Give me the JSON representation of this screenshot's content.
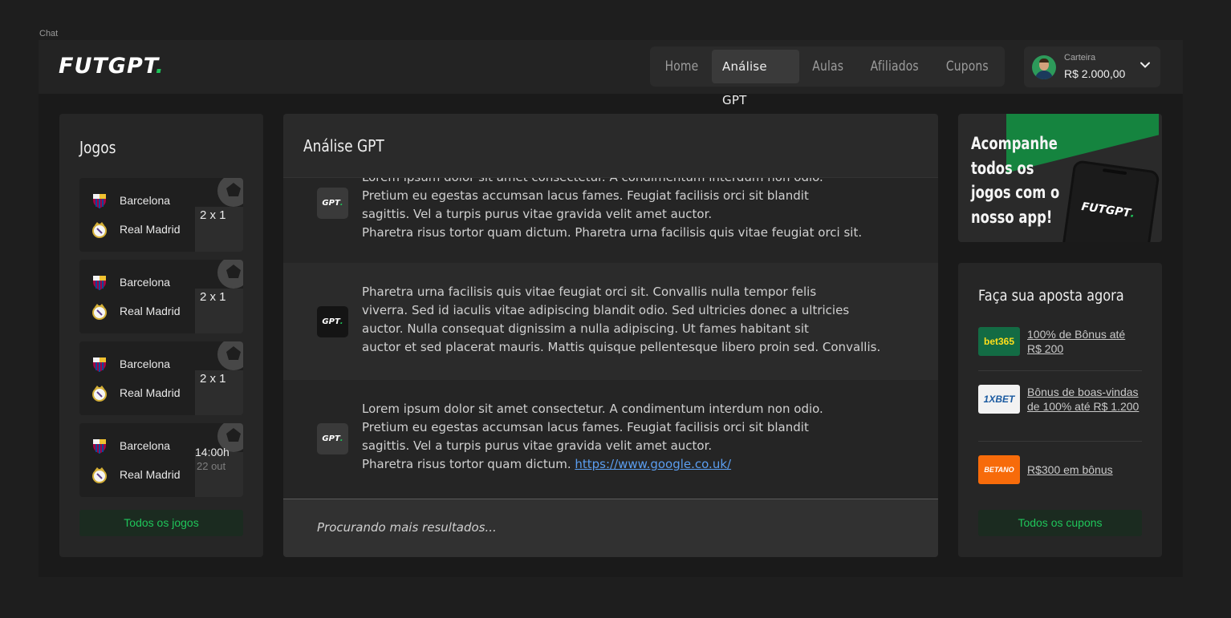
{
  "frame_label": "Chat",
  "brand": {
    "logo_main": "FUTGPT",
    "logo_dot": ".",
    "accent": "#1fc55a"
  },
  "nav": {
    "items": [
      {
        "label": "Home"
      },
      {
        "label": "Análise GPT",
        "active": true
      },
      {
        "label": "Aulas"
      },
      {
        "label": "Afiliados"
      },
      {
        "label": "Cupons"
      }
    ]
  },
  "wallet": {
    "label": "Carteira",
    "value": "R$ 2.000,00"
  },
  "games": {
    "title": "Jogos",
    "items": [
      {
        "home": "Barcelona",
        "away": "Real Madrid",
        "score": "2 x 1"
      },
      {
        "home": "Barcelona",
        "away": "Real Madrid",
        "score": "2 x 1"
      },
      {
        "home": "Barcelona",
        "away": "Real Madrid",
        "score": "2 x 1"
      },
      {
        "home": "Barcelona",
        "away": "Real Madrid",
        "time": "14:00h",
        "date": "22 out"
      }
    ],
    "button": "Todos os jogos"
  },
  "chat": {
    "title": "Análise GPT",
    "icon_text": "GPT",
    "messages": [
      {
        "lines": [
          "Lorem ipsum dolor sit amet consectetur. A condimentum interdum non odio.",
          "Pretium eu egestas accumsan lacus fames. Feugiat facilisis orci sit blandit",
          "sagittis. Vel a turpis purus vitae gravida velit amet auctor.",
          "Pharetra risus tortor quam dictum. Pharetra urna facilisis quis vitae feugiat orci sit."
        ]
      },
      {
        "lines": [
          "Pharetra urna facilisis quis vitae feugiat orci sit. Convallis nulla tempor felis",
          "viverra. Sed id iaculis vitae adipiscing blandit odio. Sed ultricies donec a ultricies",
          "auctor. Nulla consequat dignissim a nulla adipiscing. Ut fames habitant sit",
          "auctor et sed placerat mauris. Mattis quisque pellentesque libero proin sed. Convallis."
        ]
      },
      {
        "lines": [
          "Lorem ipsum dolor sit amet consectetur. A condimentum interdum non odio.",
          "Pretium eu egestas accumsan lacus fames. Feugiat facilisis orci sit blandit",
          "sagittis. Vel a turpis purus vitae gravida velit amet auctor."
        ],
        "last_line_prefix": "Pharetra risus tortor quam dictum.",
        "link": "https://www.google.co.uk/"
      }
    ],
    "status": "Procurando mais resultados..."
  },
  "promo": {
    "lines": [
      "Acompanhe",
      "todos os",
      "jogos com o",
      "nosso app!"
    ],
    "phone_logo": "FUTGPT"
  },
  "bets": {
    "title": "Faça sua aposta agora",
    "items": [
      {
        "brand": "bet365",
        "offer": "100% de Bônus até R$ 200",
        "color": "#136b44"
      },
      {
        "brand": "1XBET",
        "offer": "Bônus de boas-vindas de 100% até R$ 1.200",
        "color": "#ffffff"
      },
      {
        "brand": "BETANO",
        "offer": "R$300 em bônus",
        "color": "#f76b0a"
      }
    ],
    "button": "Todos os cupons"
  }
}
